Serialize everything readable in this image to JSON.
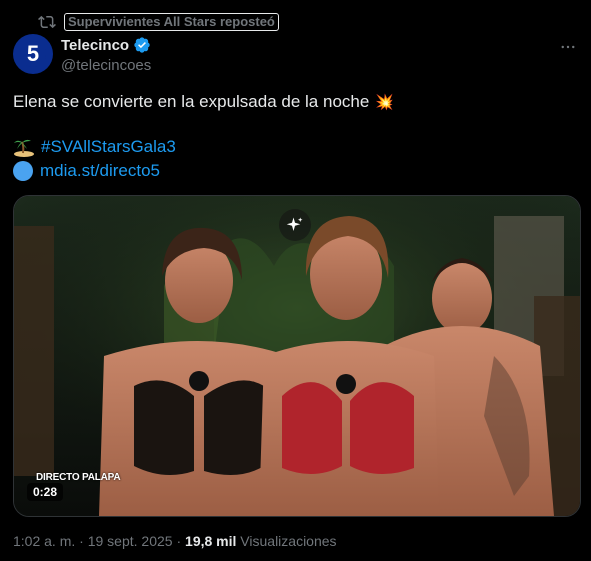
{
  "repost": {
    "label": "Supervivientes All Stars reposteó"
  },
  "author": {
    "display_name": "Telecinco",
    "handle": "@telecincoes",
    "avatar_glyph": "5"
  },
  "tweet": {
    "text": "Elena se convierte en la expulsada de la noche",
    "text_emoji": "💥",
    "hashtag": "#SVAllStarsGala3",
    "link": "mdia.st/directo5"
  },
  "media": {
    "live_label": "DIRECTO PALAPA",
    "duration": "0:28"
  },
  "meta": {
    "time": "1:02 a. m.",
    "separator": "·",
    "date": "19 sept. 2025",
    "views_count": "19,8 mil",
    "views_label": "Visualizaciones"
  },
  "colors": {
    "link": "#1d9bf0",
    "secondary_text": "#71767b",
    "primary_text": "#e7e9ea",
    "verified": "#1d9bf0",
    "avatar_bg": "#0a2d8f"
  },
  "icons": [
    "repost-icon",
    "verified-badge-icon",
    "more-icon",
    "island-emoji-icon",
    "sparkle-icon"
  ]
}
